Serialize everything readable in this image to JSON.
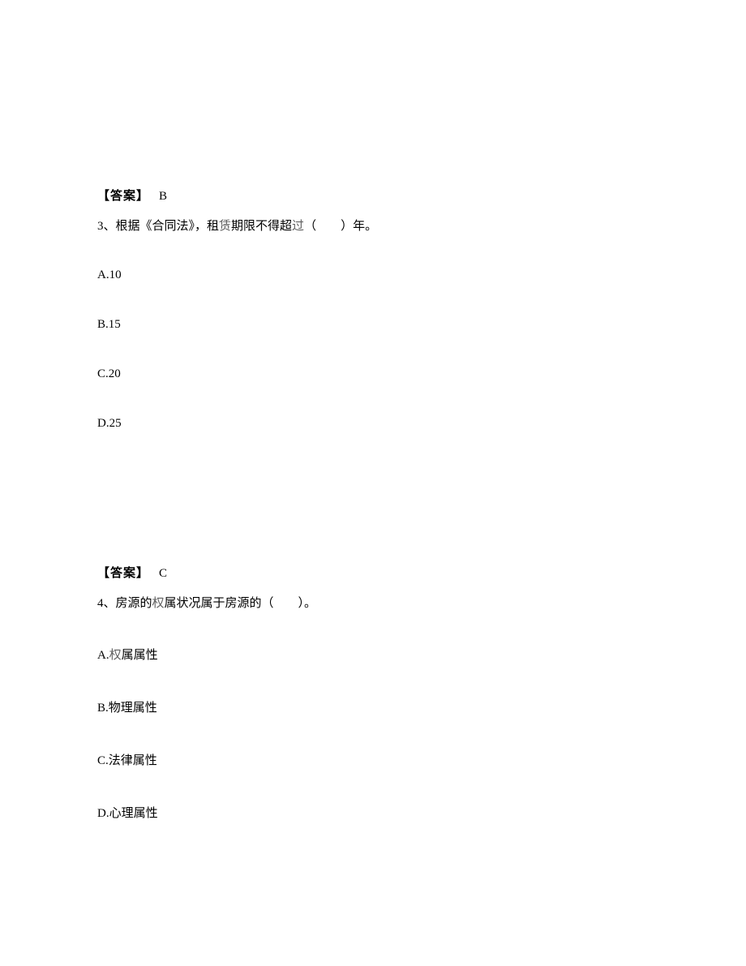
{
  "q2_answer": {
    "label": "【答案】",
    "value": "B"
  },
  "q3": {
    "stem_prefix": "3、根据《合同法》，租",
    "stem_special": "赁",
    "stem_mid": "期限不得超",
    "stem_special2": "过",
    "stem_suffix": "（　　）年。",
    "options": {
      "a": "A.10",
      "b": "B.15",
      "c": "C.20",
      "d": "D.25"
    },
    "answer": {
      "label": "【答案】",
      "value": "C"
    }
  },
  "q4": {
    "stem_prefix": "4、房源的",
    "stem_special": "权",
    "stem_suffix": "属状况属于房源的（　　）。",
    "options": {
      "a_prefix": "A.",
      "a_special": "权",
      "a_suffix": "属属性",
      "b": "B.物理属性",
      "c": "C.法律属性",
      "d": "D.心理属性"
    }
  }
}
